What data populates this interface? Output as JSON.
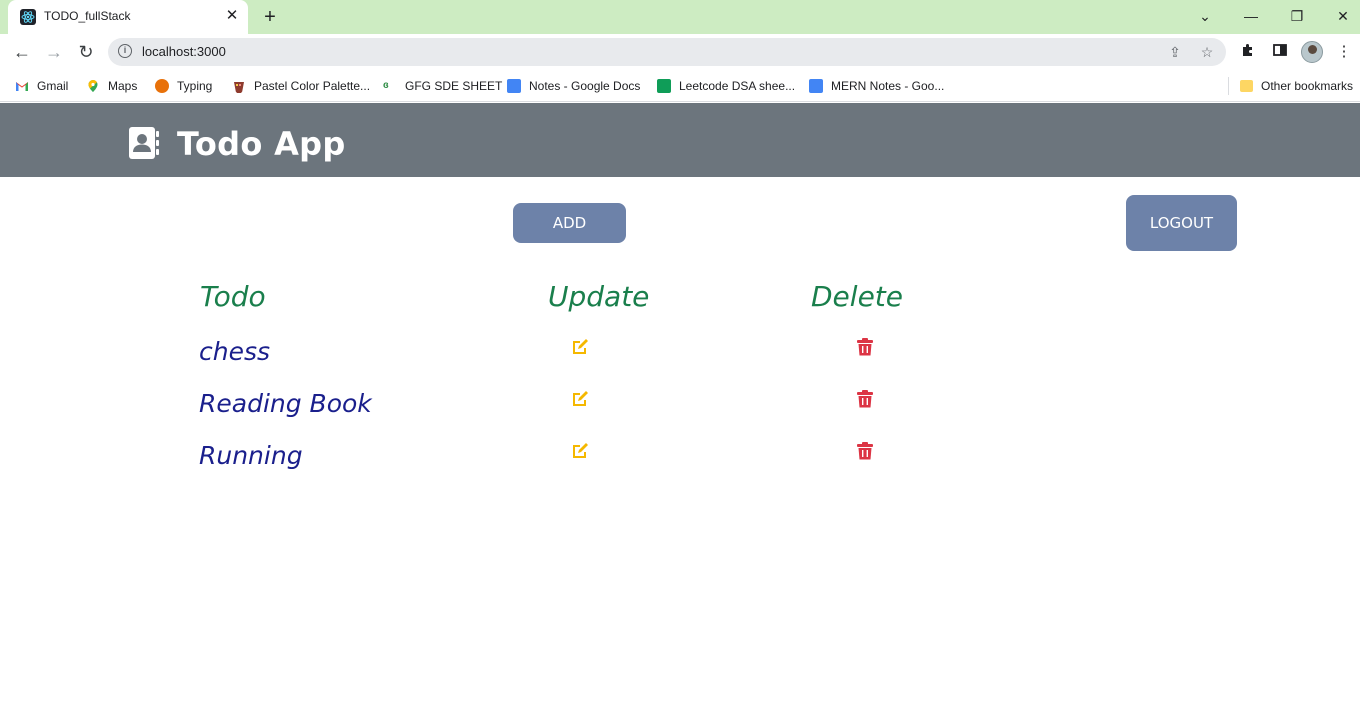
{
  "browser": {
    "tab_title": "TODO_fullStack",
    "tab_close": "✕",
    "new_tab": "+",
    "url": "localhost:3000",
    "controls": {
      "collapse": "⌄",
      "minimize": "—",
      "restore": "❐",
      "close": "✕"
    },
    "nav": {
      "back": "←",
      "forward": "→",
      "reload": "↻"
    },
    "bookmarks": [
      {
        "label": "Gmail",
        "icon": "gmail-icon",
        "color": "#ea4335"
      },
      {
        "label": "Maps",
        "icon": "maps-pin-icon",
        "color": "#34a853"
      },
      {
        "label": "Typing",
        "icon": "typing-icon",
        "color": "#e8710a"
      },
      {
        "label": "Pastel Color Palette...",
        "icon": "palette-icon",
        "color": "#8e3b2e"
      },
      {
        "label": "GFG SDE SHEET",
        "icon": "gfg-icon",
        "color": "#2f8d46"
      },
      {
        "label": "Notes - Google Docs",
        "icon": "docs-icon",
        "color": "#4285f4"
      },
      {
        "label": "Leetcode DSA shee...",
        "icon": "sheets-icon",
        "color": "#0f9d58"
      },
      {
        "label": "MERN Notes - Goo...",
        "icon": "docs-icon",
        "color": "#4285f4"
      }
    ],
    "other_bookmarks": "Other bookmarks"
  },
  "app": {
    "title": "Todo App",
    "add_label": "ADD",
    "logout_label": "LOGOUT",
    "headers": {
      "todo": "Todo",
      "update": "Update",
      "delete": "Delete"
    },
    "todos": [
      {
        "text": "chess"
      },
      {
        "text": "Reading Book"
      },
      {
        "text": "Running"
      }
    ],
    "colors": {
      "header_bg": "#6c757d",
      "button_bg": "#6d82a9",
      "heading_green": "#1a7f4c",
      "todo_blue": "#1a1f8c",
      "edit_yellow": "#f5b800",
      "delete_red": "#dc3545"
    }
  }
}
